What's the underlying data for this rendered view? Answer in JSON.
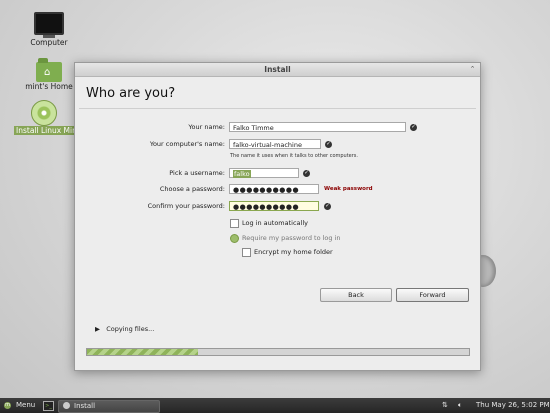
{
  "desktop": {
    "icons": [
      {
        "label": "Computer"
      },
      {
        "label": "mint's Home"
      },
      {
        "label": "Install Linux Mint"
      }
    ]
  },
  "window": {
    "title": "Install",
    "heading": "Who are you?",
    "fields": {
      "name": {
        "label": "Your name:",
        "value": "Falko Timme"
      },
      "computer": {
        "label": "Your computer's name:",
        "value": "falko-virtual-machine",
        "hint": "The name it uses when it talks to other computers."
      },
      "username": {
        "label": "Pick a username:",
        "value": "falko"
      },
      "password": {
        "label": "Choose a password:",
        "value": "●●●●●●●●●●",
        "strength": "Weak password"
      },
      "confirm": {
        "label": "Confirm your password:",
        "value": "●●●●●●●●●●"
      }
    },
    "options": {
      "auto_login": {
        "label": "Log in automatically",
        "checked": false
      },
      "require_password": {
        "label": "Require my password to log in",
        "checked": true
      },
      "encrypt_home": {
        "label": "Encrypt my home folder",
        "checked": false
      }
    },
    "buttons": {
      "back": "Back",
      "forward": "Forward"
    },
    "status": {
      "text": "Copying files...",
      "progress": 0.29
    }
  },
  "panel": {
    "menu_label": "Menu",
    "task_label": "Install",
    "clock": "Thu May 26,  5:02 PM"
  },
  "colors": {
    "accent": "#87a556",
    "warning": "#8b0000"
  }
}
